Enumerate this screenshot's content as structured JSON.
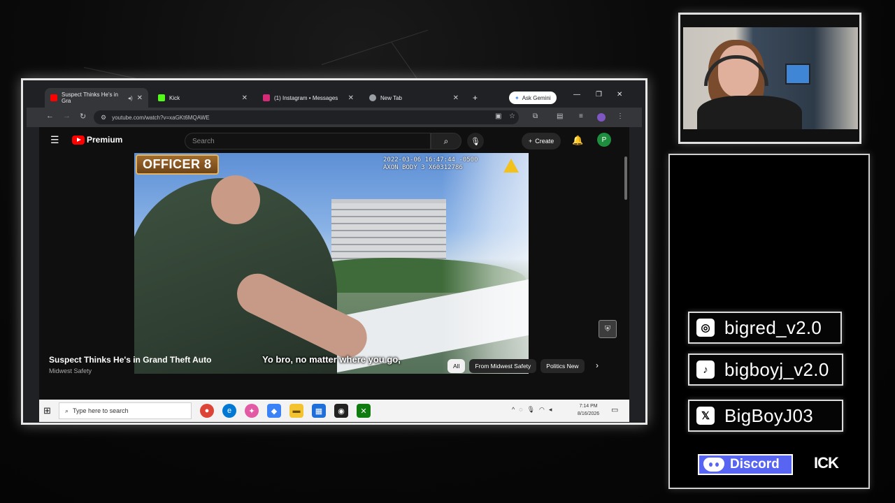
{
  "browser": {
    "tabs": [
      {
        "label": "Suspect Thinks He's in Gra",
        "active": true,
        "favicon_color": "#ff0000"
      },
      {
        "label": "Kick",
        "active": false,
        "favicon_color": "#53fc18"
      },
      {
        "label": "(1) Instagram • Messages",
        "active": false,
        "favicon_color": "#d62976"
      },
      {
        "label": "New Tab",
        "active": false,
        "favicon_color": "#9aa0a6"
      }
    ],
    "ask_gemini": "Ask Gemini",
    "url": "youtube.com/watch?v=xaGKt6MQAWE"
  },
  "youtube": {
    "brand": "Premium",
    "search_placeholder": "Search",
    "create_label": "Create",
    "avatar_letter": "P",
    "video": {
      "overlay_label": "OFFICER 8",
      "cam_stamp_line1": "2022-03-06 16:47:44 -0500",
      "cam_stamp_line2": "AXON BODY 3 X60312786",
      "subtitle": "Yo bro, no matter where you go,"
    },
    "title": "Suspect Thinks He's in Grand Theft Auto",
    "channel_stub": "Midwest Safety",
    "chips": [
      "All",
      "From Midwest Safety",
      "Politics New"
    ]
  },
  "taskbar": {
    "search_placeholder": "Type here to search",
    "time": "7:14 PM",
    "date": "8/16/2026"
  },
  "socials": {
    "instagram": "bigred_v2.0",
    "tiktok": "bigboyj_v2.0",
    "x": "BigBoyJ03",
    "discord": "Discord",
    "kick": "ICK"
  },
  "colors": {
    "accent_red": "#ff0000",
    "discord": "#5865f2",
    "frame": "#e8e8e8"
  }
}
